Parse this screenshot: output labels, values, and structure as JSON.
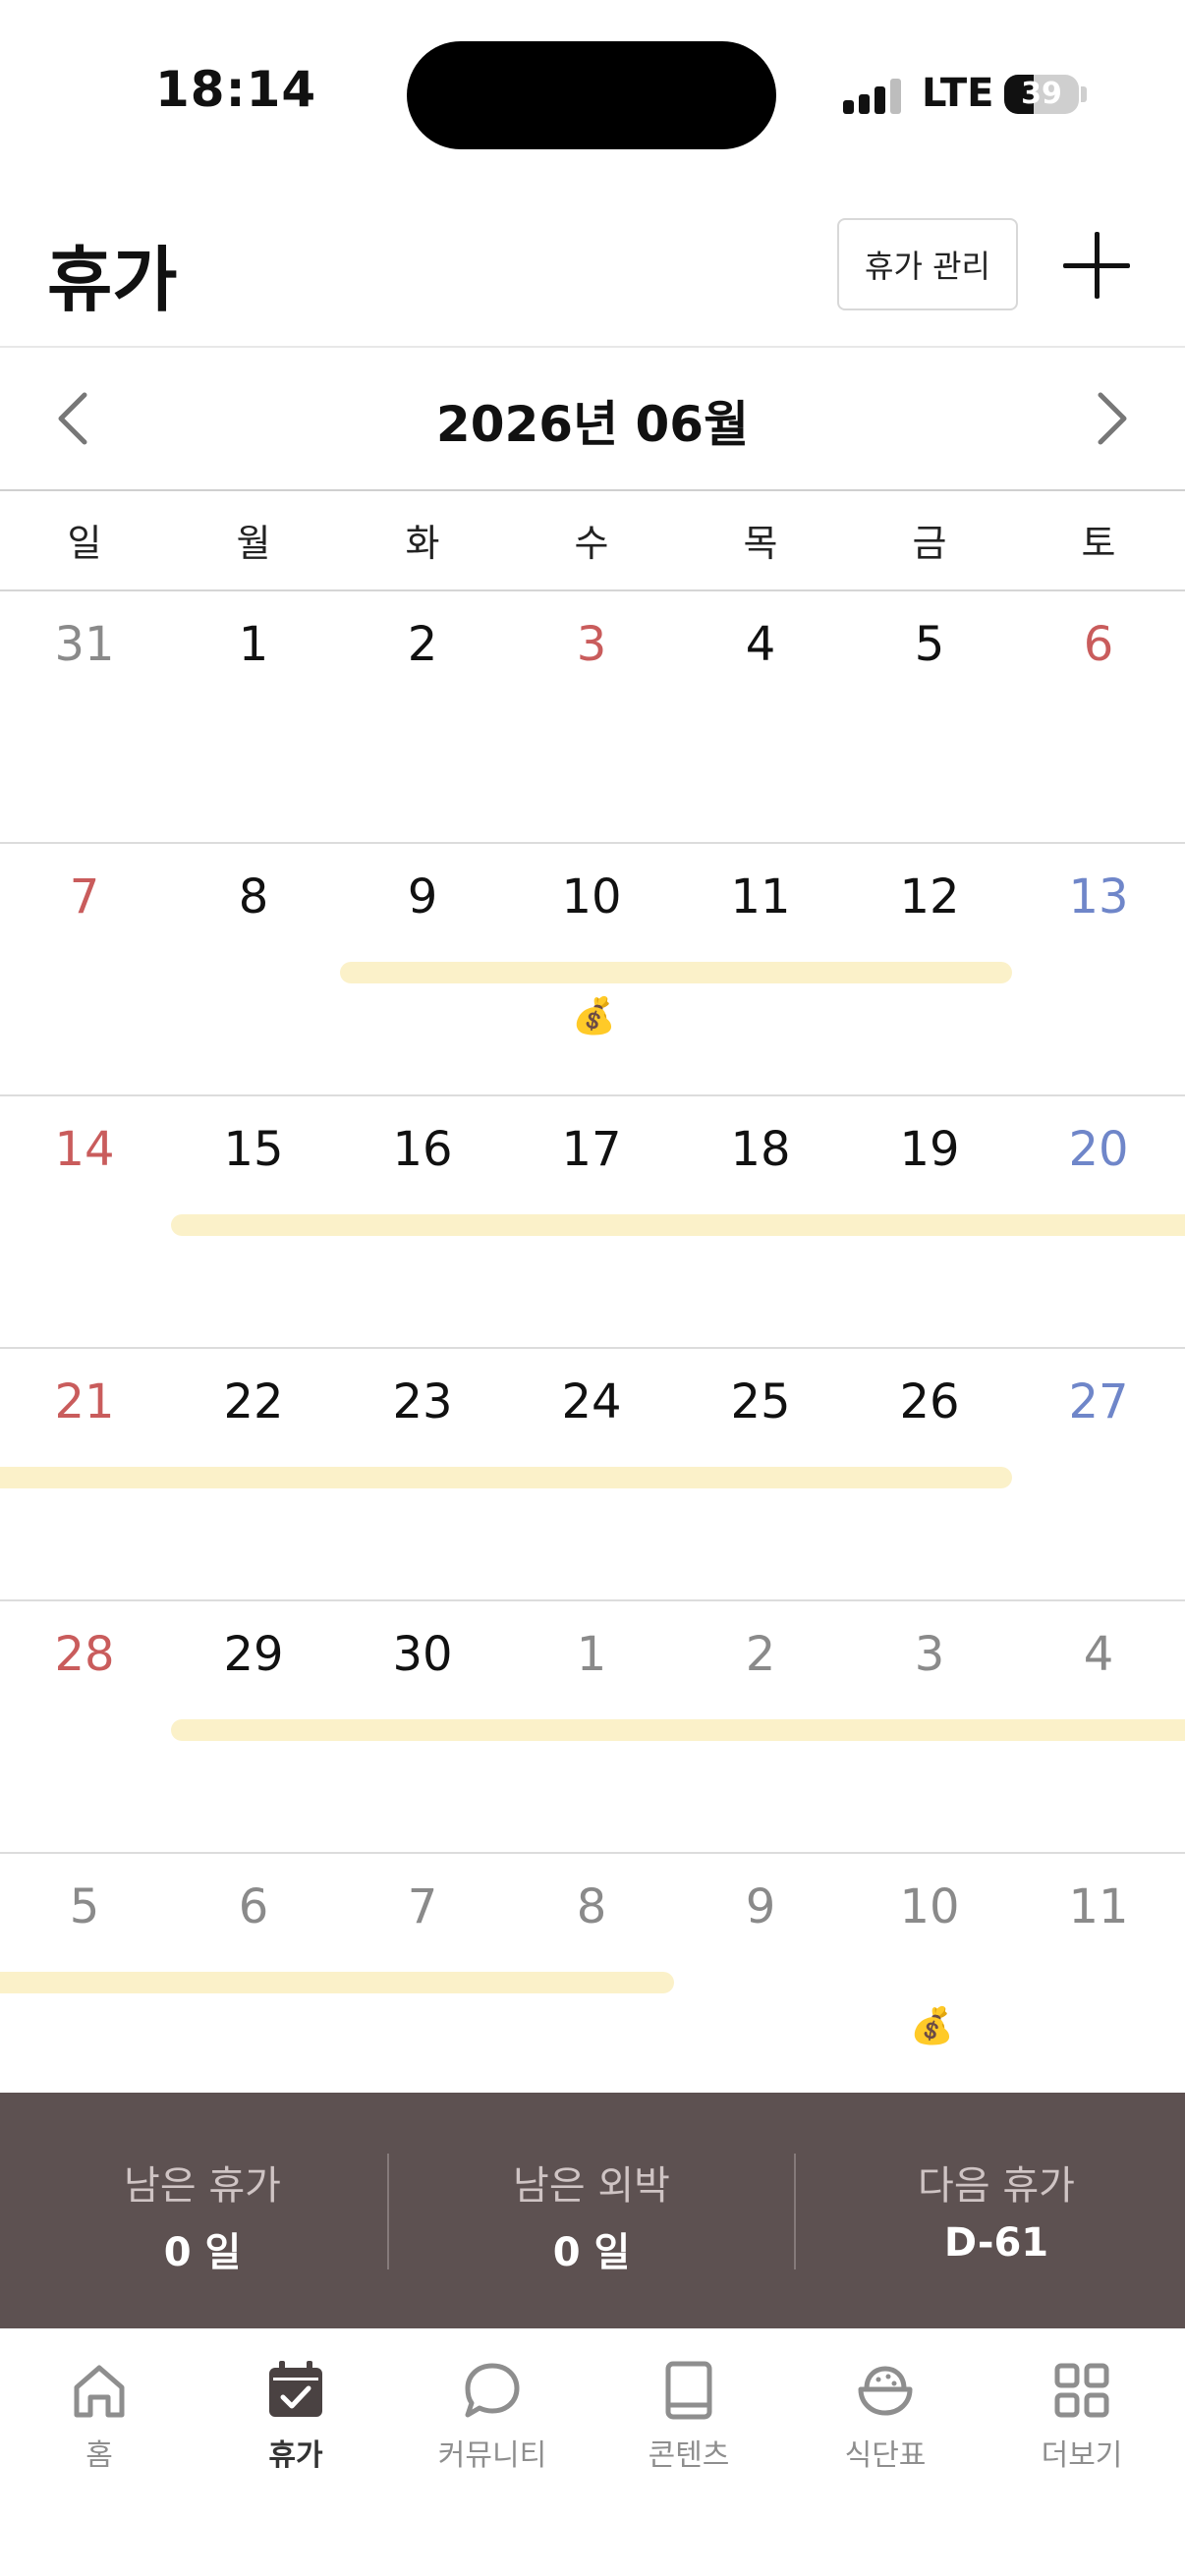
{
  "status_bar": {
    "time": "18:14",
    "network": "LTE",
    "battery": "39",
    "battery_level_percent": 39
  },
  "header": {
    "title": "휴가",
    "manage_label": "휴가 관리"
  },
  "calendar": {
    "month_label": "2026년 06월",
    "weekdays": [
      "일",
      "월",
      "화",
      "수",
      "목",
      "금",
      "토"
    ],
    "weeks": [
      [
        "31",
        "1",
        "2",
        "3",
        "4",
        "5",
        "6"
      ],
      [
        "7",
        "8",
        "9",
        "10",
        "11",
        "12",
        "13"
      ],
      [
        "14",
        "15",
        "16",
        "17",
        "18",
        "19",
        "20"
      ],
      [
        "21",
        "22",
        "23",
        "24",
        "25",
        "26",
        "27"
      ],
      [
        "28",
        "29",
        "30",
        "1",
        "2",
        "3",
        "4"
      ],
      [
        "5",
        "6",
        "7",
        "8",
        "9",
        "10",
        "11"
      ]
    ],
    "money_bag_emoji": "💰",
    "colors": {
      "sunday_holiday": "#c95c5c",
      "saturday": "#6f86c9",
      "other_month": "#8a8a8a",
      "normal": "#111111",
      "event_bar": "#fbf1c9"
    }
  },
  "summary": {
    "items": [
      {
        "label": "남은 휴가",
        "value": "0 일"
      },
      {
        "label": "남은 외박",
        "value": "0 일"
      },
      {
        "label": "다음 휴가",
        "value": "D-61"
      }
    ]
  },
  "tab_bar": {
    "items": [
      {
        "label": "홈",
        "icon": "home-icon"
      },
      {
        "label": "휴가",
        "icon": "calendar-check-icon",
        "active": true
      },
      {
        "label": "커뮤니티",
        "icon": "chat-bubble-icon"
      },
      {
        "label": "콘텐츠",
        "icon": "book-icon"
      },
      {
        "label": "식단표",
        "icon": "rice-bowl-icon"
      },
      {
        "label": "더보기",
        "icon": "grid-icon"
      }
    ]
  }
}
